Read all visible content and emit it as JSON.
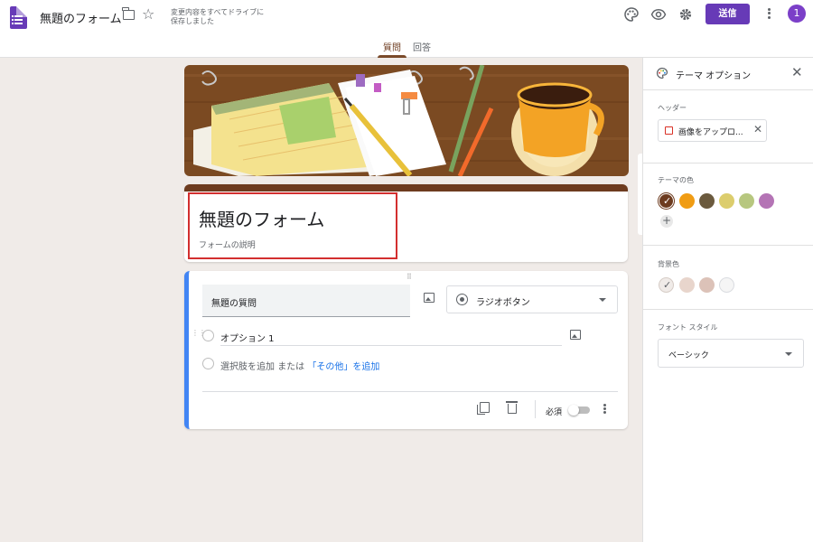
{
  "app": {
    "doc_title": "無題のフォーム",
    "save_status": "変更内容をすべてドライブに保存しました",
    "send_label": "送信",
    "avatar_initial": "1"
  },
  "tabs": [
    {
      "label": "質問",
      "active": true
    },
    {
      "label": "回答",
      "active": false
    }
  ],
  "form": {
    "title": "無題のフォーム",
    "description_placeholder": "フォームの説明"
  },
  "question": {
    "title": "無題の質問",
    "type": "ラジオボタン",
    "options": [
      {
        "label": "オプション 1"
      }
    ],
    "add_option": "選択肢を追加",
    "add_or": "または",
    "add_other": "「その他」を追加",
    "required_label": "必須",
    "required": false
  },
  "theme_panel": {
    "title": "テーマ オプション",
    "header_label": "ヘッダー",
    "upload_label": "画像をアップロ...",
    "theme_color_label": "テーマの色",
    "theme_colors": [
      "#6d3b1f",
      "#f09c14",
      "#6b5a3e",
      "#dccd6d",
      "#b7c77f",
      "#b474b5"
    ],
    "selected_theme_color": 0,
    "background_label": "背景色",
    "background_colors": [
      "#f0ebe8",
      "#e8d5cc",
      "#dcc2b8",
      "#f5f5f5"
    ],
    "selected_background": 0,
    "font_style_label": "フォント スタイル",
    "font_style": "ベーシック"
  },
  "colors": {
    "brand": "#673ab7",
    "accent": "#6d3b1f",
    "question_border": "#4285f4",
    "highlight": "#d32f2f",
    "background": "#f0ebe8"
  },
  "icons": [
    "forms-app-icon",
    "folder-icon",
    "star-icon",
    "palette-icon",
    "eye-icon",
    "gear-icon",
    "more-vert-icon",
    "image-icon",
    "radio-button-icon",
    "copy-icon",
    "trash-icon",
    "close-icon",
    "add-icon",
    "check-icon",
    "chevron-down-icon"
  ]
}
